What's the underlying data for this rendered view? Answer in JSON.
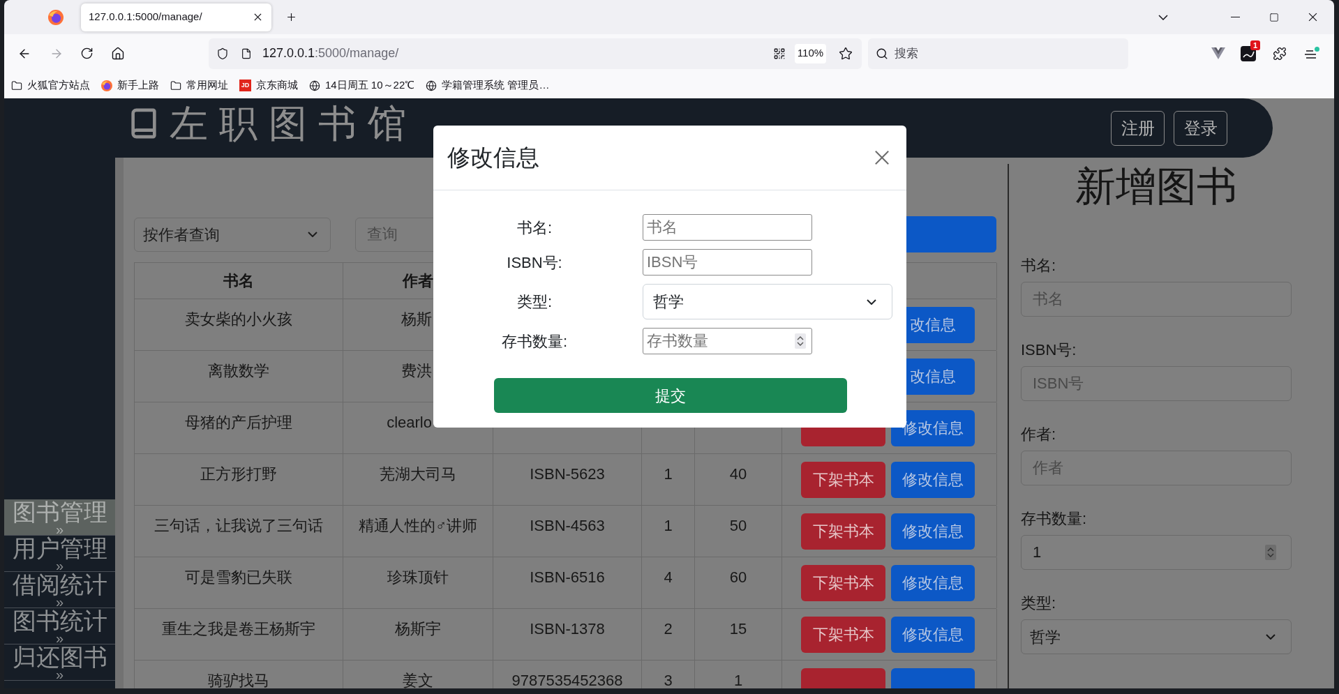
{
  "browser": {
    "tabs": [
      {
        "title": "127.0.0.1:5000/manage/",
        "selected": true
      }
    ],
    "address": {
      "host": "127.0.0.1",
      "rest": ":5000/manage/"
    },
    "zoom_level": "110%",
    "search": {
      "placeholder": "搜索"
    },
    "extension_badge": "1",
    "bookmarks": [
      {
        "kind": "folder",
        "label": "火狐官方站点"
      },
      {
        "kind": "browser",
        "label": "新手上路"
      },
      {
        "kind": "folder",
        "label": "常用网址"
      },
      {
        "kind": "shop",
        "icon_text": "JD",
        "label": "京东商城"
      },
      {
        "kind": "globe",
        "label": "14日周五 10～22℃"
      },
      {
        "kind": "globe",
        "label": "学籍管理系统 管理员…"
      }
    ]
  },
  "header": {
    "title": "左职图书馆",
    "buttons": [
      "注册",
      "登录"
    ]
  },
  "sidebar": {
    "items": [
      {
        "label": "图书管理",
        "arrow": "»",
        "selected": true
      },
      {
        "label": "用户管理",
        "arrow": "»",
        "selected": false
      },
      {
        "label": "借阅统计",
        "arrow": "»",
        "selected": false
      },
      {
        "label": "图书统计",
        "arrow": "»",
        "selected": false
      },
      {
        "label": "归还图书",
        "arrow": "»",
        "selected": false
      }
    ]
  },
  "search_bar": {
    "mode": "按作者查询",
    "placeholder": "查询"
  },
  "table": {
    "columns": [
      "书名",
      "作者"
    ],
    "rows": [
      {
        "title": "卖女柴的小火孩",
        "author": "杨斯",
        "buttons": [
          {
            "kind": "primary",
            "label": "改信息"
          }
        ]
      },
      {
        "title": "离散数学",
        "author": "费洪",
        "buttons": [
          {
            "kind": "primary",
            "label": "改信息"
          }
        ]
      },
      {
        "title": "母猪的产后护理",
        "author": "clearlo",
        "buttons": [
          {
            "kind": "danger"
          },
          {
            "kind": "primary",
            "label": "修改信息"
          }
        ]
      },
      {
        "title": "正方形打野",
        "author": "芜湖大司马",
        "column_3": "ISBN-5623",
        "column_4": "1",
        "column_5": "40",
        "buttons": [
          {
            "kind": "danger",
            "label": "下架书本"
          },
          {
            "kind": "primary",
            "label": "修改信息"
          }
        ]
      },
      {
        "title": "三句话，让我说了三句话",
        "author": "精通人性的♂讲师",
        "column_3": "ISBN-4563",
        "column_4": "1",
        "column_5": "50",
        "buttons": [
          {
            "kind": "danger",
            "label": "下架书本"
          },
          {
            "kind": "primary",
            "label": "修改信息"
          }
        ]
      },
      {
        "title": "可是雪豹已失联",
        "author": "珍珠顶针",
        "column_3": "ISBN-6516",
        "column_4": "4",
        "column_5": "60",
        "buttons": [
          {
            "kind": "danger",
            "label": "下架书本"
          },
          {
            "kind": "primary",
            "label": "修改信息"
          }
        ]
      },
      {
        "title": "重生之我是卷王杨斯宇",
        "author": "杨斯宇",
        "column_3": "ISBN-1378",
        "column_4": "2",
        "column_5": "15",
        "buttons": [
          {
            "kind": "danger",
            "label": "下架书本"
          },
          {
            "kind": "primary",
            "label": "修改信息"
          }
        ]
      },
      {
        "title": "骑驴找马",
        "author": "姜文",
        "column_3": "9787535452368",
        "column_4": "3",
        "column_5": "1",
        "buttons": [
          {
            "kind": "danger"
          },
          {
            "kind": "primary"
          }
        ]
      }
    ]
  },
  "add_form": {
    "title": "新增图书",
    "fields": [
      {
        "kind": "text",
        "label": "书名:",
        "placeholder": "书名"
      },
      {
        "kind": "text",
        "label": "ISBN号:",
        "placeholder": "ISBN号"
      },
      {
        "kind": "text",
        "label": "作者:",
        "placeholder": "作者"
      },
      {
        "kind": "number",
        "label": "存书数量:",
        "value": "1"
      },
      {
        "kind": "select",
        "label": "类型:",
        "value": "哲学"
      }
    ]
  },
  "modal": {
    "title": "修改信息",
    "fields": [
      {
        "kind": "text",
        "label": "书名:",
        "placeholder": "书名"
      },
      {
        "kind": "text",
        "label": "ISBN号:",
        "placeholder": "IBSN号"
      },
      {
        "kind": "select",
        "label": "类型:",
        "value": "哲学"
      },
      {
        "kind": "number",
        "label": "存书数量:",
        "placeholder": "存书数量"
      }
    ],
    "submit": "提交"
  }
}
